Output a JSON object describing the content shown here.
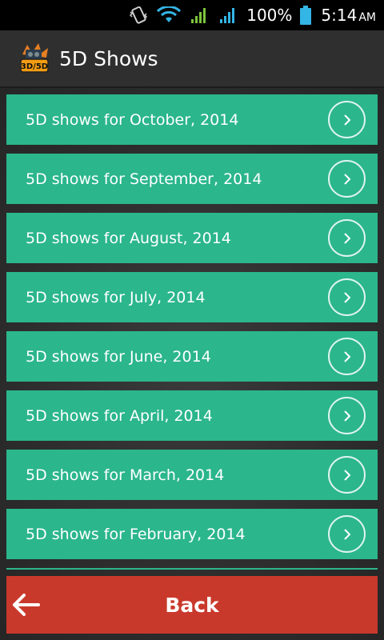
{
  "status_bar": {
    "battery_percent": "100%",
    "time": "5:14",
    "ampm": "AM"
  },
  "action_bar": {
    "title": "5D Shows",
    "logo_text": "3D/5D"
  },
  "shows": [
    {
      "label": "5D shows for October, 2014"
    },
    {
      "label": "5D shows for September, 2014"
    },
    {
      "label": "5D shows for August, 2014"
    },
    {
      "label": "5D shows for July, 2014"
    },
    {
      "label": "5D shows for June, 2014"
    },
    {
      "label": "5D shows for April, 2014"
    },
    {
      "label": "5D shows for March, 2014"
    },
    {
      "label": "5D shows for February, 2014"
    }
  ],
  "back_button": {
    "label": "Back"
  },
  "colors": {
    "item_bg": "#2bb68b",
    "back_bg": "#c9392b",
    "action_bar_bg": "#2f2f2f",
    "status_bar_bg": "#000000"
  }
}
